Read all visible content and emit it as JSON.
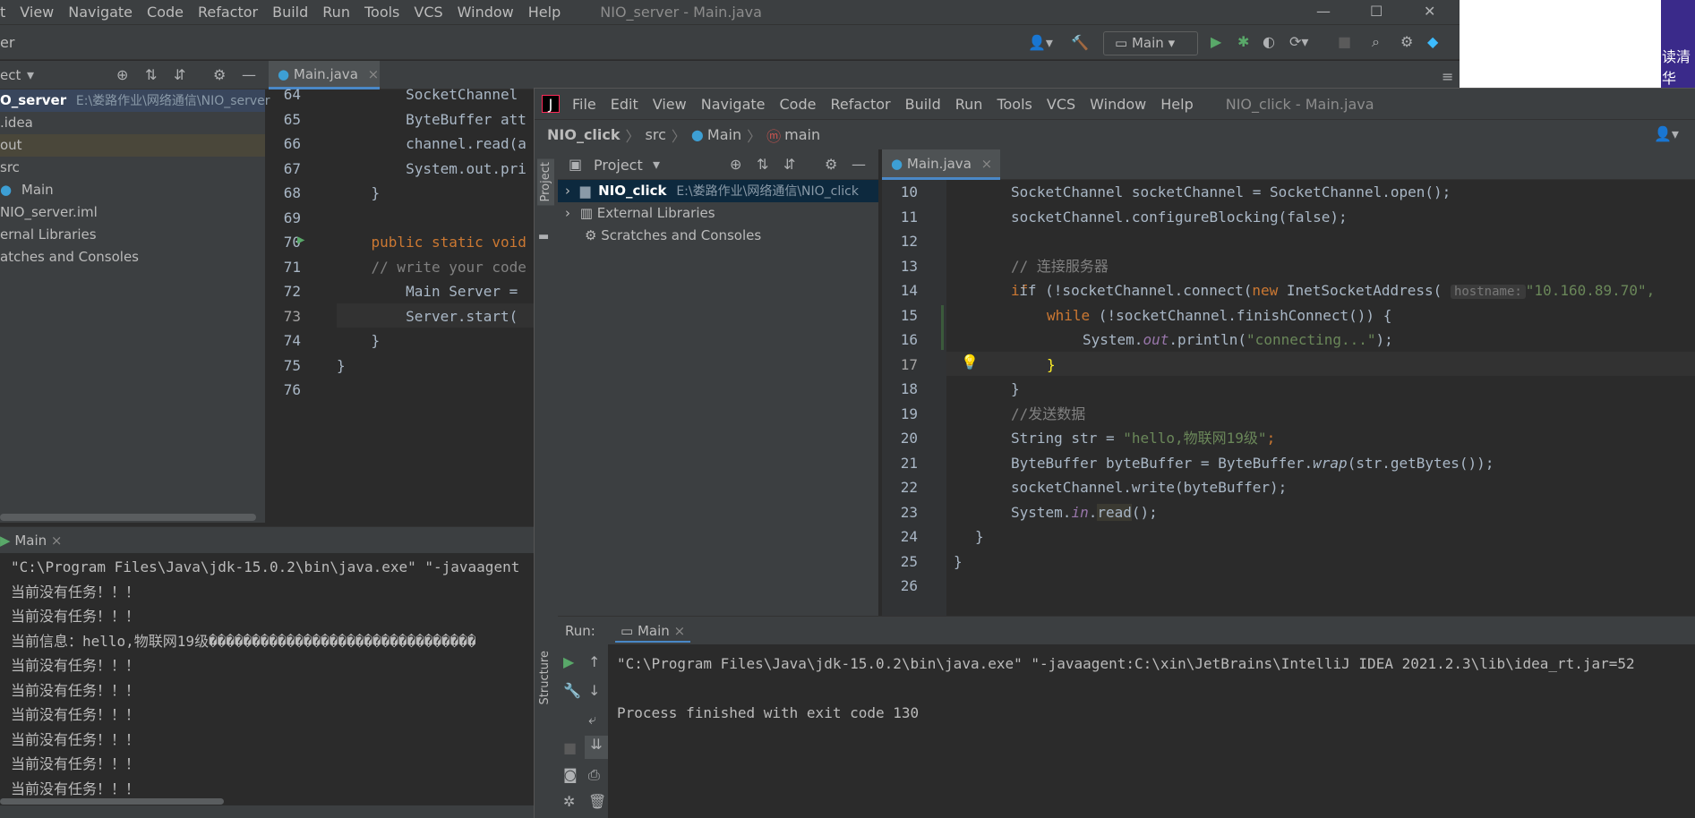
{
  "back": {
    "title": "NIO_server - Main.java",
    "menu": [
      "t",
      "View",
      "Navigate",
      "Code",
      "Refactor",
      "Build",
      "Run",
      "Tools",
      "VCS",
      "Window",
      "Help"
    ],
    "toolbar_fragment": "er",
    "run_config": "Main",
    "project_label": "ect",
    "tab": "Main.java",
    "tree": [
      {
        "label": "O_server",
        "path": "E:\\娄路作业\\网络通信\\NIO_server"
      },
      {
        "label": ".idea"
      },
      {
        "label": "out"
      },
      {
        "label": "src"
      },
      {
        "label": "Main"
      },
      {
        "label": "NIO_server.iml"
      },
      {
        "label": "ernal Libraries"
      },
      {
        "label": "atches and Consoles"
      }
    ],
    "line_numbers": [
      "64",
      "65",
      "66",
      "67",
      "68",
      "69",
      "70",
      "71",
      "72",
      "73",
      "74",
      "75",
      "76"
    ],
    "code": [
      "        SocketChannel",
      "        ByteBuffer att",
      "        channel.read(a",
      "        System.out.pri",
      "    }",
      "",
      "    public static void",
      "    // write your code",
      "        Main Server =",
      "        Server.start(",
      "    }",
      "}",
      ""
    ],
    "run_tab": "Main",
    "console": [
      "\"C:\\Program Files\\Java\\jdk-15.0.2\\bin\\java.exe\" \"-javaagent",
      "当前没有任务！！！",
      "当前没有任务！！！",
      "当前信息：hello,物联网19级�������������������������������",
      "当前没有任务！！！",
      "当前没有任务！！！",
      "当前没有任务！！！",
      "当前没有任务！！！",
      "当前没有任务！！！",
      "当前没有任务！！！"
    ]
  },
  "front": {
    "title": "NIO_click - Main.java",
    "menu": [
      "File",
      "Edit",
      "View",
      "Navigate",
      "Code",
      "Refactor",
      "Build",
      "Run",
      "Tools",
      "VCS",
      "Window",
      "Help"
    ],
    "breadcrumbs": [
      "NIO_click",
      "src",
      "Main",
      "main"
    ],
    "project_label": "Project",
    "side_label_project": "Project",
    "side_label_structure": "Structure",
    "tree": [
      {
        "label": "NIO_click",
        "path": "E:\\娄路作业\\网络通信\\NIO_click"
      },
      {
        "label": "External Libraries"
      },
      {
        "label": "Scratches and Consoles"
      }
    ],
    "tab": "Main.java",
    "line_numbers": [
      "10",
      "11",
      "12",
      "13",
      "14",
      "15",
      "16",
      "17",
      "18",
      "19",
      "20",
      "21",
      "22",
      "23",
      "24",
      "25",
      "26"
    ],
    "code": {
      "l10": "SocketChannel socketChannel = SocketChannel.open();",
      "l11": "socketChannel.configureBlocking(false);",
      "l13": "// 连接服务器",
      "l14a": "if (!socketChannel.connect(",
      "l14b": "new",
      "l14c": " InetSocketAddress(",
      "l14hint": "hostname:",
      "l14str": "\"10.160.89.70\",",
      "l15a": "while",
      "l15b": " (!socketChannel.finishConnect()) {",
      "l16a": "System.",
      "l16b": "out",
      "l16c": ".println(",
      "l16d": "\"connecting...\"",
      "l16e": ");",
      "l17": "}",
      "l18": "}",
      "l19": "//发送数据",
      "l20a": "String str = ",
      "l20b": "\"hello,物联网19级\"",
      "l20c": ";",
      "l21a": "ByteBuffer byteBuffer = ByteBuffer.",
      "l21b": "wrap",
      "l21c": "(str.getBytes());",
      "l22": "socketChannel.write(byteBuffer);",
      "l23a": "System.",
      "l23b": "in",
      "l23c": ".",
      "l23d": "read",
      "l23e": "();",
      "l24": "}",
      "l25": "}"
    },
    "run_label": "Run:",
    "run_tab": "Main",
    "console": [
      "\"C:\\Program Files\\Java\\jdk-15.0.2\\bin\\java.exe\" \"-javaagent:C:\\xin\\JetBrains\\IntelliJ IDEA 2021.2.3\\lib\\idea_rt.jar=52",
      "",
      "Process finished with exit code 130"
    ]
  },
  "desktop": {
    "right_text": "读清华"
  },
  "colors": {
    "bg": "#2b2b2b",
    "chrome": "#3c3f41",
    "keyword": "#cc7832",
    "string": "#6a8759",
    "comment": "#808080",
    "accent": "#4a88c7"
  }
}
